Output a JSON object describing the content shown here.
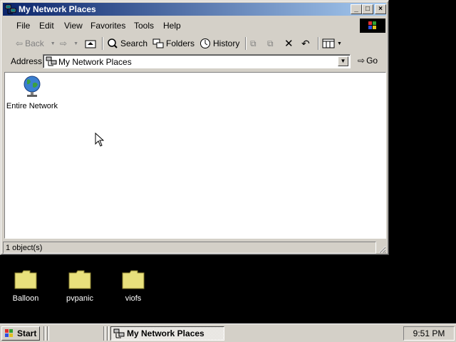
{
  "window": {
    "title": "My Network Places",
    "controls": {
      "minimize": "_",
      "maximize": "□",
      "close": "×"
    }
  },
  "menubar": [
    "File",
    "Edit",
    "View",
    "Favorites",
    "Tools",
    "Help"
  ],
  "toolbar": {
    "back": "Back",
    "search": "Search",
    "folders": "Folders",
    "history": "History"
  },
  "address": {
    "label": "Address",
    "value": "My Network Places",
    "go": "Go"
  },
  "content": {
    "items": [
      {
        "label": "Entire Network",
        "icon": "globe-icon"
      }
    ]
  },
  "status": {
    "text": "1 object(s)"
  },
  "desktop": {
    "icons": [
      {
        "label": "Balloon",
        "icon": "folder-icon"
      },
      {
        "label": "pvpanic",
        "icon": "folder-icon"
      },
      {
        "label": "viofs",
        "icon": "folder-icon"
      }
    ]
  },
  "taskbar": {
    "start": "Start",
    "task": "My Network Places",
    "clock": "9:51 PM"
  },
  "colors": {
    "title_gradient_start": "#0a246a",
    "title_gradient_end": "#a6caf0",
    "face": "#d4d0c8",
    "folder": "#e8e07c"
  }
}
